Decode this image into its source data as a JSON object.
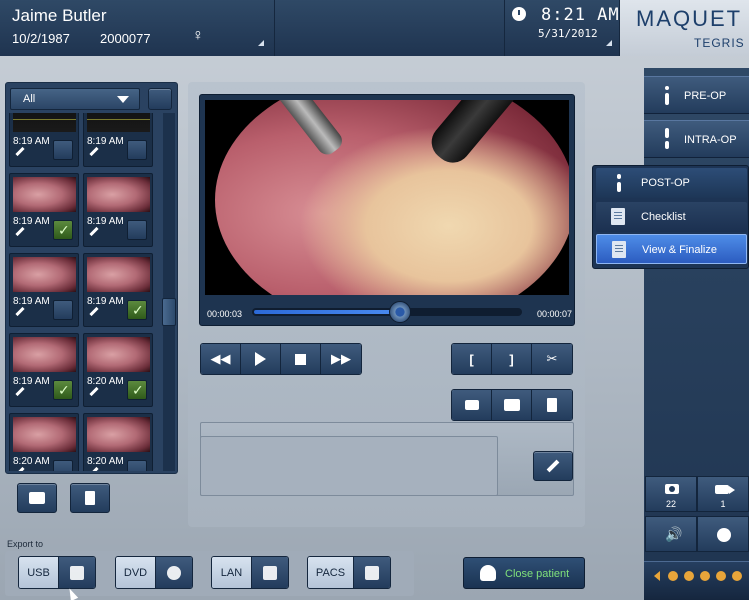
{
  "patient": {
    "name": "Jaime Butler",
    "dob": "10/2/1987",
    "id": "2000077",
    "gender_symbol": "♀"
  },
  "clock": {
    "time": "8:21 AM",
    "date": "5/31/2012"
  },
  "brand": {
    "name": "MAQUET",
    "sub": "TEGRIS"
  },
  "filter": {
    "selected": "All"
  },
  "thumbnails": [
    {
      "time": "8:19 AM",
      "checked": false
    },
    {
      "time": "8:19 AM",
      "checked": false
    },
    {
      "time": "8:19 AM",
      "checked": true
    },
    {
      "time": "8:19 AM",
      "checked": false
    },
    {
      "time": "8:19 AM",
      "checked": false
    },
    {
      "time": "8:19 AM",
      "checked": true
    },
    {
      "time": "8:19 AM",
      "checked": true
    },
    {
      "time": "8:20 AM",
      "checked": true
    },
    {
      "time": "8:20 AM",
      "checked": false
    },
    {
      "time": "8:20 AM",
      "checked": false
    }
  ],
  "video": {
    "current_time": "00:00:03",
    "total_time": "00:00:07",
    "progress": 0.55
  },
  "transport": {
    "mark_in": "[",
    "mark_out": "]"
  },
  "nav": {
    "preop": "PRE-OP",
    "intraop": "INTRA-OP",
    "postop": "POST-OP",
    "checklist": "Checklist",
    "view_finalize": "View & Finalize"
  },
  "counters": {
    "photos": "22",
    "videos": "1"
  },
  "export": {
    "label": "Export to",
    "usb": "USB",
    "dvd": "DVD",
    "lan": "LAN",
    "pacs": "PACS"
  },
  "close_patient": "Close patient",
  "icons": [
    "rewind-icon",
    "play-icon",
    "stop-icon",
    "forward-icon",
    "scissors-icon",
    "camera-icon",
    "print-icon",
    "trash-icon",
    "pencil-icon",
    "clock-icon",
    "speaker-icon",
    "network-icon"
  ],
  "colors": {
    "accent_blue": "#3a78dc",
    "check_green": "#5c8a3e",
    "close_text": "#7fe07a"
  }
}
